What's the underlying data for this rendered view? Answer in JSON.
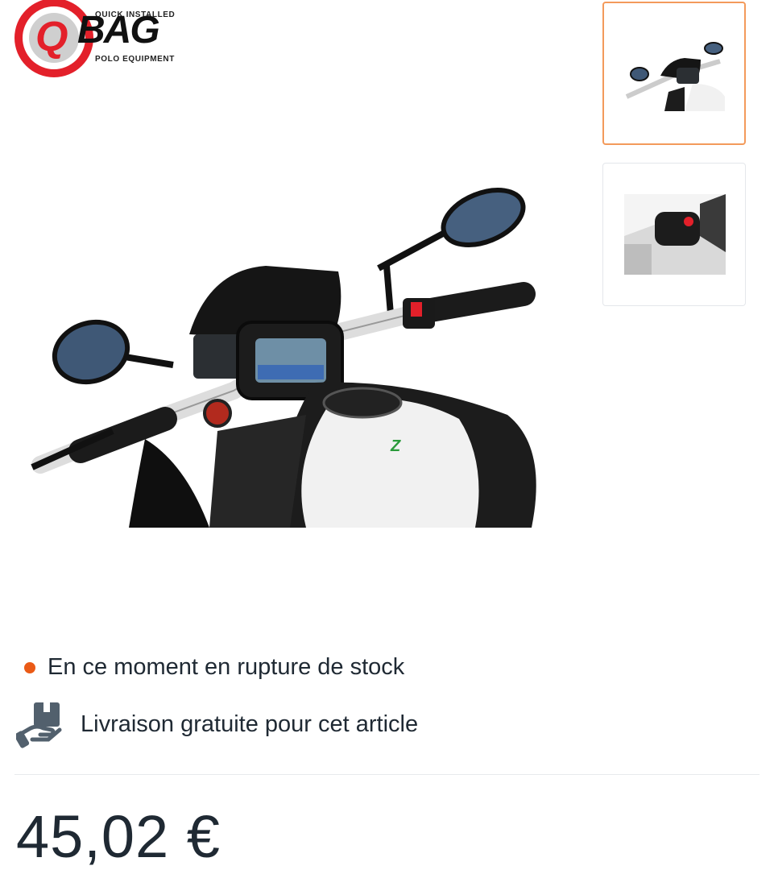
{
  "brand": {
    "logo_top": "QUICK INSTALLED",
    "logo_letter": "Q",
    "logo_word": "BAG",
    "logo_bottom": "POLO EQUIPMENT"
  },
  "gallery": {
    "main_image_icon": "motorcycle-tank-bag-photo",
    "thumbnails": [
      {
        "icon": "motorcycle-handlebar-thumbnail",
        "active": true
      },
      {
        "icon": "tank-bag-thumbnail",
        "active": false
      }
    ]
  },
  "availability": {
    "stock_text": "En ce moment en rupture de stock",
    "stock_dot_color": "#ea5a16",
    "delivery_text": "Livraison gratuite pour cet article",
    "delivery_icon": "hand-package-icon"
  },
  "price": {
    "value": "45,02 €"
  },
  "colors": {
    "accent": "#f39a5b",
    "text": "#1f2933"
  }
}
